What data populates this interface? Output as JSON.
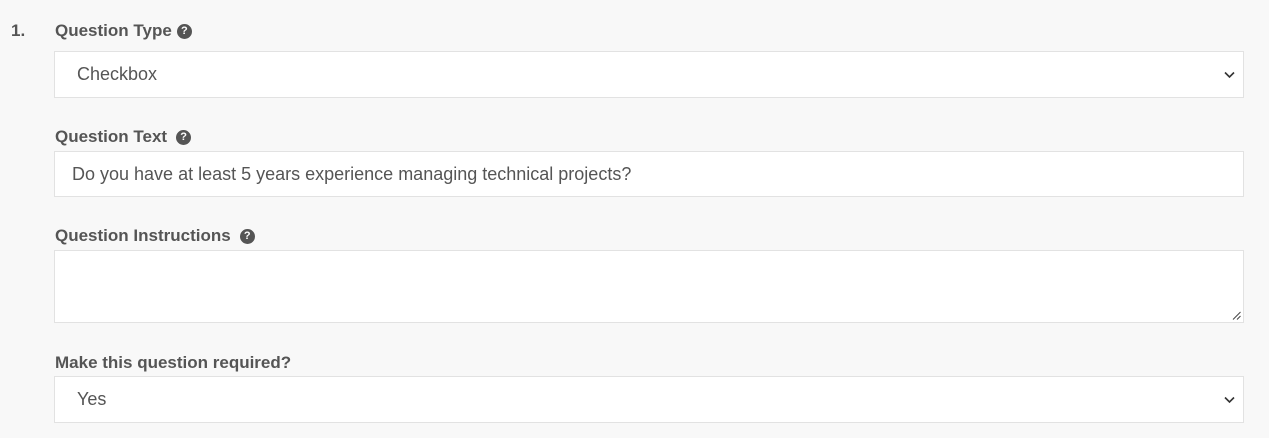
{
  "question": {
    "number": "1.",
    "type": {
      "label": "Question Type",
      "value": "Checkbox",
      "help_icon": "question-circle-icon"
    },
    "text": {
      "label": "Question Text",
      "value": "Do you have at least 5 years experience managing technical projects?",
      "help_icon": "question-circle-icon"
    },
    "instructions": {
      "label": "Question Instructions",
      "value": "",
      "help_icon": "question-circle-icon"
    },
    "required": {
      "label": "Make this question required?",
      "value": "Yes"
    }
  },
  "colors": {
    "background": "#f8f8f8",
    "text": "#555555",
    "border": "#e2e2e2",
    "field_background": "#ffffff"
  }
}
